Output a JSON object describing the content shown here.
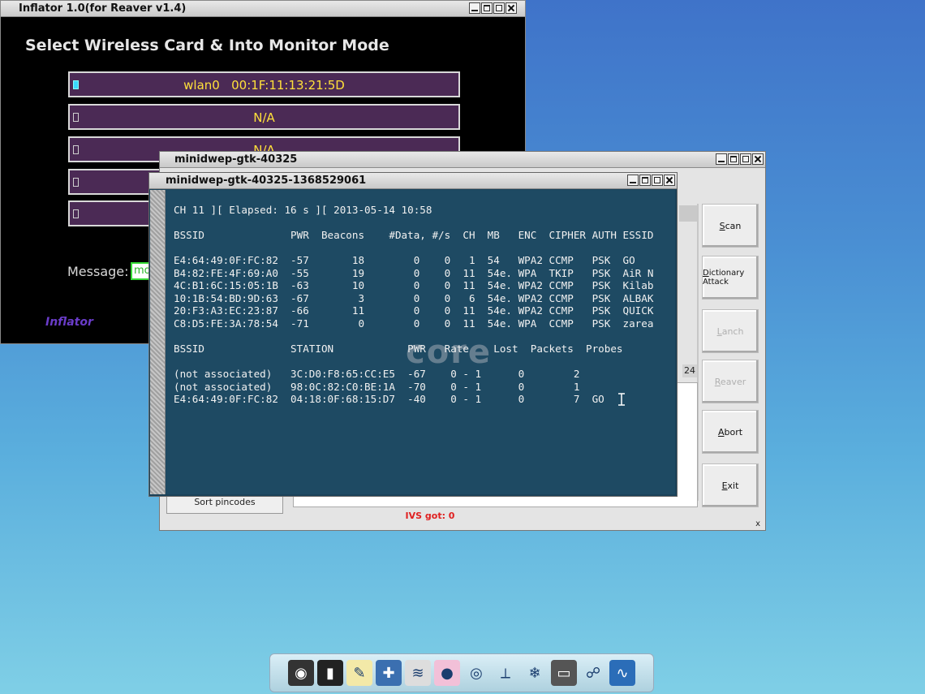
{
  "inflator": {
    "title": "Inflator 1.0(for Reaver v1.4)",
    "heading": "Select Wireless Card & Into Monitor Mode",
    "cards": [
      {
        "label": "wlan0   00:1F:11:13:21:5D",
        "selected": true
      },
      {
        "label": "N/A",
        "selected": false
      },
      {
        "label": "N/A",
        "selected": false
      },
      {
        "label": "",
        "selected": false
      },
      {
        "label": "",
        "selected": false
      }
    ],
    "message_label": "Message:",
    "message_value": "mo",
    "brand": "Inflator"
  },
  "minidwep": {
    "title": "minidwep-gtk-40325",
    "buttons": [
      {
        "label": "Scan",
        "underline": "S",
        "rest": "can",
        "enabled": true
      },
      {
        "label": "Dictionary Attack",
        "underline": "D",
        "rest": "ictionary Attack",
        "enabled": true
      },
      {
        "label": "Lanch",
        "underline": "L",
        "rest": "anch",
        "enabled": false
      },
      {
        "label": "Reaver",
        "underline": "R",
        "rest": "eaver",
        "enabled": false
      },
      {
        "label": "Abort",
        "underline": "A",
        "rest": "bort",
        "enabled": true
      },
      {
        "label": "Exit",
        "underline": "E",
        "rest": "xit",
        "enabled": true
      }
    ],
    "count": "24",
    "sort_button": "Sort pincodes",
    "ivs_status": "IVS got: 0",
    "close_mark": "x"
  },
  "terminal": {
    "title": "minidwep-gtk-40325-1368529061",
    "status_line": "CH 11 ][ Elapsed: 16 s ][ 2013-05-14 10:58",
    "ap_header": "BSSID              PWR  Beacons    #Data, #/s  CH  MB   ENC  CIPHER AUTH ESSID",
    "ap_rows": [
      "E4:64:49:0F:FC:82  -57       18        0    0   1  54   WPA2 CCMP   PSK  GO",
      "B4:82:FE:4F:69:A0  -55       19        0    0  11  54e. WPA  TKIP   PSK  AiR N",
      "4C:B1:6C:15:05:1B  -63       10        0    0  11  54e. WPA2 CCMP   PSK  Kilab",
      "10:1B:54:BD:9D:63  -67        3        0    0   6  54e. WPA2 CCMP   PSK  ALBAK",
      "20:F3:A3:EC:23:87  -66       11        0    0  11  54e. WPA2 CCMP   PSK  QUICK",
      "C8:D5:FE:3A:78:54  -71        0        0    0  11  54e. WPA  CCMP   PSK  zarea"
    ],
    "station_header": "BSSID              STATION            PWR   Rate    Lost  Packets  Probes",
    "station_rows": [
      "(not associated)   3C:D0:F8:65:CC:E5  -67    0 - 1      0        2",
      "(not associated)   98:0C:82:C0:BE:1A  -70    0 - 1      0        1",
      "E4:64:49:0F:FC:82  04:18:0F:68:15:D7  -40    0 - 1      0        7  GO"
    ],
    "watermark": "core"
  },
  "dock": {
    "items": [
      {
        "name": "settings-icon",
        "glyph": "◉",
        "bg": "#333"
      },
      {
        "name": "terminal-icon",
        "glyph": "▮",
        "bg": "#222"
      },
      {
        "name": "text-editor-icon",
        "glyph": "✎",
        "bg": "#f3e9a8"
      },
      {
        "name": "tools-icon",
        "glyph": "✚",
        "bg": "#3b6fb0"
      },
      {
        "name": "network-monitor-icon",
        "glyph": "≋",
        "bg": "#ddd"
      },
      {
        "name": "pills-icon",
        "glyph": "●",
        "bg": "#f2c0d8"
      },
      {
        "name": "core-logo-icon",
        "glyph": "◎",
        "bg": "transparent"
      },
      {
        "name": "signal-tool-icon",
        "glyph": "⟂",
        "bg": "transparent"
      },
      {
        "name": "snowflake-icon",
        "glyph": "❄",
        "bg": "transparent"
      },
      {
        "name": "monitor-icon",
        "glyph": "▭",
        "bg": "#555"
      },
      {
        "name": "wireless-icon",
        "glyph": "☍",
        "bg": "transparent"
      },
      {
        "name": "graph-icon",
        "glyph": "∿",
        "bg": "#2b6db8"
      }
    ]
  }
}
